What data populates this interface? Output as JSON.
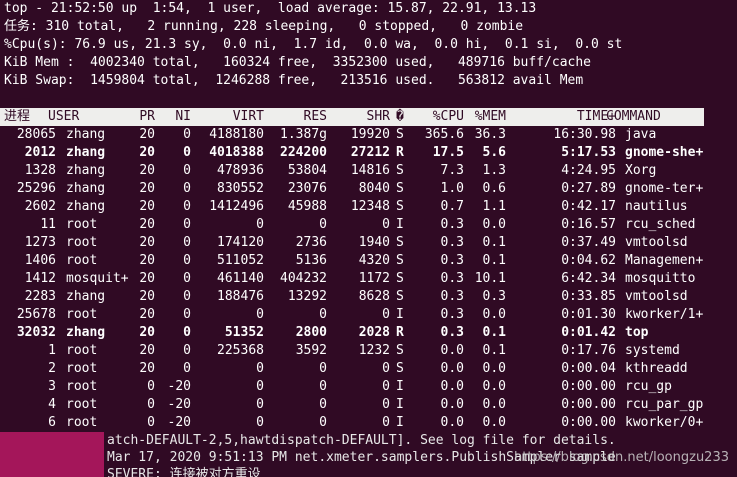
{
  "summary": {
    "line1": "top - 21:52:50 up  1:54,  1 user,  load average: 15.87, 22.91, 13.13",
    "line2": "任务: 310 total,   2 running, 228 sleeping,   0 stopped,   0 zombie",
    "line3": "%Cpu(s): 76.9 us, 21.3 sy,  0.0 ni,  1.7 id,  0.0 wa,  0.0 hi,  0.1 si,  0.0 st",
    "line4": "KiB Mem :  4002340 total,   160324 free,  3352300 used,   489716 buff/cache",
    "line5": "KiB Swap:  1459804 total,  1246288 free,   213516 used.   563812 avail Mem"
  },
  "header": {
    "pid": "进程",
    "user": "USER",
    "pr": "PR",
    "ni": "NI",
    "virt": "VIRT",
    "res": "RES",
    "shr": "SHR",
    "s": "�",
    "cpu": "%CPU",
    "mem": "%MEM",
    "time": "TIME+",
    "command": "COMMAND"
  },
  "processes": [
    {
      "pid": "28065",
      "user": "zhang",
      "pr": "20",
      "ni": "0",
      "virt": "4188180",
      "res": "1.387g",
      "shr": "19920",
      "s": "S",
      "cpu": "365.6",
      "mem": "36.3",
      "time": "16:30.98",
      "command": "java",
      "bold": false
    },
    {
      "pid": "2012",
      "user": "zhang",
      "pr": "20",
      "ni": "0",
      "virt": "4018388",
      "res": "224200",
      "shr": "27212",
      "s": "R",
      "cpu": "17.5",
      "mem": "5.6",
      "time": "5:17.53",
      "command": "gnome-she+",
      "bold": true
    },
    {
      "pid": "1328",
      "user": "zhang",
      "pr": "20",
      "ni": "0",
      "virt": "478936",
      "res": "53804",
      "shr": "14816",
      "s": "S",
      "cpu": "7.3",
      "mem": "1.3",
      "time": "4:24.95",
      "command": "Xorg",
      "bold": false
    },
    {
      "pid": "25296",
      "user": "zhang",
      "pr": "20",
      "ni": "0",
      "virt": "830552",
      "res": "23076",
      "shr": "8040",
      "s": "S",
      "cpu": "1.0",
      "mem": "0.6",
      "time": "0:27.89",
      "command": "gnome-ter+",
      "bold": false
    },
    {
      "pid": "2602",
      "user": "zhang",
      "pr": "20",
      "ni": "0",
      "virt": "1412496",
      "res": "45988",
      "shr": "12348",
      "s": "S",
      "cpu": "0.7",
      "mem": "1.1",
      "time": "0:42.17",
      "command": "nautilus",
      "bold": false
    },
    {
      "pid": "11",
      "user": "root",
      "pr": "20",
      "ni": "0",
      "virt": "0",
      "res": "0",
      "shr": "0",
      "s": "I",
      "cpu": "0.3",
      "mem": "0.0",
      "time": "0:16.57",
      "command": "rcu_sched",
      "bold": false
    },
    {
      "pid": "1273",
      "user": "root",
      "pr": "20",
      "ni": "0",
      "virt": "174120",
      "res": "2736",
      "shr": "1940",
      "s": "S",
      "cpu": "0.3",
      "mem": "0.1",
      "time": "0:37.49",
      "command": "vmtoolsd",
      "bold": false
    },
    {
      "pid": "1406",
      "user": "root",
      "pr": "20",
      "ni": "0",
      "virt": "511052",
      "res": "5136",
      "shr": "4320",
      "s": "S",
      "cpu": "0.3",
      "mem": "0.1",
      "time": "0:04.62",
      "command": "Managemen+",
      "bold": false
    },
    {
      "pid": "1412",
      "user": "mosquit+",
      "pr": "20",
      "ni": "0",
      "virt": "461140",
      "res": "404232",
      "shr": "1172",
      "s": "S",
      "cpu": "0.3",
      "mem": "10.1",
      "time": "6:42.34",
      "command": "mosquitto",
      "bold": false
    },
    {
      "pid": "2283",
      "user": "zhang",
      "pr": "20",
      "ni": "0",
      "virt": "188476",
      "res": "13292",
      "shr": "8628",
      "s": "S",
      "cpu": "0.3",
      "mem": "0.3",
      "time": "0:33.85",
      "command": "vmtoolsd",
      "bold": false
    },
    {
      "pid": "25678",
      "user": "root",
      "pr": "20",
      "ni": "0",
      "virt": "0",
      "res": "0",
      "shr": "0",
      "s": "I",
      "cpu": "0.3",
      "mem": "0.0",
      "time": "0:01.30",
      "command": "kworker/1+",
      "bold": false
    },
    {
      "pid": "32032",
      "user": "zhang",
      "pr": "20",
      "ni": "0",
      "virt": "51352",
      "res": "2800",
      "shr": "2028",
      "s": "R",
      "cpu": "0.3",
      "mem": "0.1",
      "time": "0:01.42",
      "command": "top",
      "bold": true
    },
    {
      "pid": "1",
      "user": "root",
      "pr": "20",
      "ni": "0",
      "virt": "225368",
      "res": "3592",
      "shr": "1232",
      "s": "S",
      "cpu": "0.0",
      "mem": "0.1",
      "time": "0:17.76",
      "command": "systemd",
      "bold": false
    },
    {
      "pid": "2",
      "user": "root",
      "pr": "20",
      "ni": "0",
      "virt": "0",
      "res": "0",
      "shr": "0",
      "s": "S",
      "cpu": "0.0",
      "mem": "0.0",
      "time": "0:00.04",
      "command": "kthreadd",
      "bold": false
    },
    {
      "pid": "3",
      "user": "root",
      "pr": "0",
      "ni": "-20",
      "virt": "0",
      "res": "0",
      "shr": "0",
      "s": "I",
      "cpu": "0.0",
      "mem": "0.0",
      "time": "0:00.00",
      "command": "rcu_gp",
      "bold": false
    },
    {
      "pid": "4",
      "user": "root",
      "pr": "0",
      "ni": "-20",
      "virt": "0",
      "res": "0",
      "shr": "0",
      "s": "I",
      "cpu": "0.0",
      "mem": "0.0",
      "time": "0:00.00",
      "command": "rcu_par_gp",
      "bold": false
    },
    {
      "pid": "6",
      "user": "root",
      "pr": "0",
      "ni": "-20",
      "virt": "0",
      "res": "0",
      "shr": "0",
      "s": "I",
      "cpu": "0.0",
      "mem": "0.0",
      "time": "0:00.00",
      "command": "kworker/0+",
      "bold": false
    }
  ],
  "background_log": {
    "line1": "atch-DEFAULT-2,5,hawtdispatch-DEFAULT]. See log file for details.",
    "line2": "Mar 17, 2020 9:51:13 PM net.xmeter.samplers.PublishSampler sample",
    "line3": "SEVERE: 连接被对方重设"
  },
  "watermark": "https://blog.csdn.net/loongzu233",
  "colors": {
    "terminal_bg": "#300a24",
    "header_bg": "#eeeeec",
    "side_panel": "#a4165a"
  }
}
